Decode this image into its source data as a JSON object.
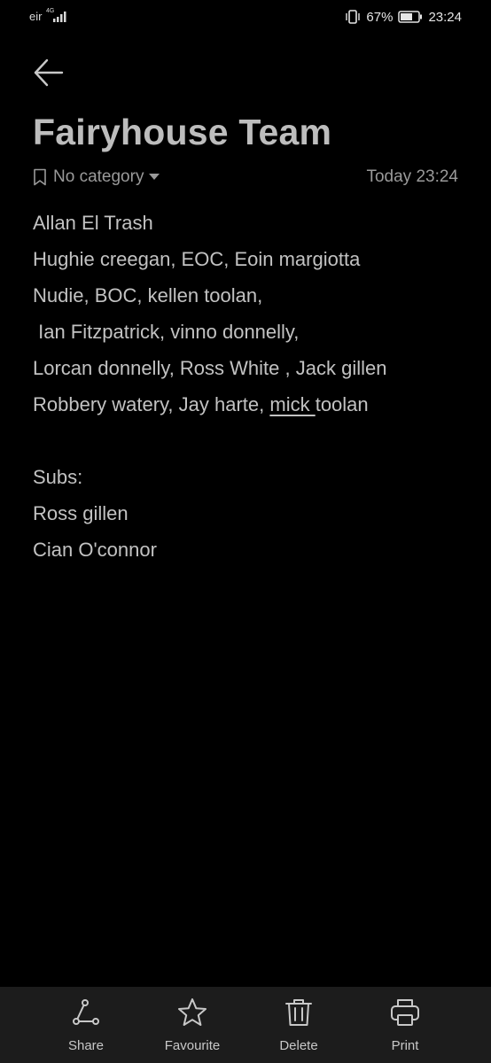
{
  "status_bar": {
    "carrier": "eir",
    "network": "4G",
    "battery_percent": "67%",
    "time": "23:24"
  },
  "header": {
    "title": "Fairyhouse Team",
    "category": "No category",
    "timestamp": "Today 23:24"
  },
  "note": {
    "lines": [
      "Allan El Trash",
      "Hughie creegan, EOC, Eoin margiotta",
      "Nudie, BOC, kellen toolan,",
      " Ian Fitzpatrick, vinno donnelly,",
      "Lorcan donnelly, Ross White , Jack gillen",
      "",
      "",
      "Subs:",
      "Ross gillen",
      "Cian O'connor"
    ],
    "line6_before": "Robbery watery, Jay harte, ",
    "line6_underlined": "mick ",
    "line6_after": "toolan"
  },
  "toolbar": {
    "share_label": "Share",
    "favourite_label": "Favourite",
    "delete_label": "Delete",
    "print_label": "Print"
  },
  "colors": {
    "background": "#000000",
    "text": "#c2c2c2",
    "muted": "#9a9a9a",
    "toolbar_bg": "#1c1c1c"
  },
  "icons": {
    "back": "arrow-left-icon",
    "category": "bookmark-icon",
    "share": "share-icon",
    "favourite": "star-icon",
    "delete": "trash-icon",
    "print": "printer-icon"
  }
}
